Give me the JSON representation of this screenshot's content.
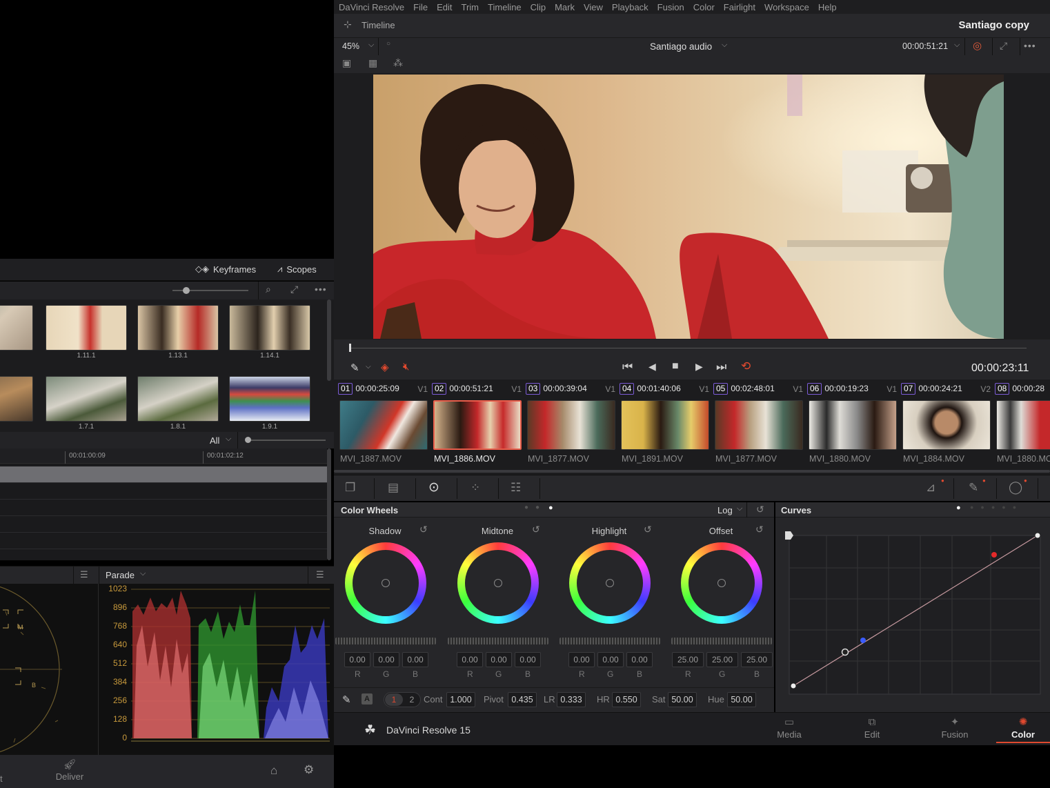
{
  "app": {
    "menu": [
      "DaVinci Resolve",
      "File",
      "Edit",
      "Trim",
      "Timeline",
      "Clip",
      "Mark",
      "View",
      "Playback",
      "Fusion",
      "Color",
      "Fairlight",
      "Workspace",
      "Help"
    ],
    "timeline_label": "Timeline",
    "project_title": "Santiago copy",
    "footer_brand": "DaVinci Resolve 15"
  },
  "viewer": {
    "zoom": "45%",
    "timeline_name": "Santiago audio",
    "source_tc": "00:00:51:21",
    "current_tc": "00:00:23:11"
  },
  "left": {
    "tabs": {
      "keyframes": "Keyframes",
      "scopes": "Scopes"
    },
    "gallery_row1": [
      "",
      "1.11.1",
      "1.13.1",
      "1.14.1"
    ],
    "gallery_row2": [
      "",
      "1.7.1",
      "1.8.1",
      "1.9.1"
    ],
    "filter": "All",
    "ruler": [
      "00:01:00:09",
      "00:01:02:12"
    ],
    "scope_mode": "Parade",
    "scope_scale": [
      "1023",
      "896",
      "768",
      "640",
      "512",
      "384",
      "256",
      "128",
      "0"
    ],
    "vector_labels": {
      "m": "M",
      "b": "B"
    },
    "page_left": "t",
    "page_deliver": "Deliver"
  },
  "clips": [
    {
      "num": "01",
      "tc": "00:00:25:09",
      "track": "V1",
      "name": "MVI_1887.MOV"
    },
    {
      "num": "02",
      "tc": "00:00:51:21",
      "track": "V1",
      "name": "MVI_1886.MOV"
    },
    {
      "num": "03",
      "tc": "00:00:39:04",
      "track": "V1",
      "name": "MVI_1877.MOV"
    },
    {
      "num": "04",
      "tc": "00:01:40:06",
      "track": "V1",
      "name": "MVI_1891.MOV"
    },
    {
      "num": "05",
      "tc": "00:02:48:01",
      "track": "V1",
      "name": "MVI_1877.MOV"
    },
    {
      "num": "06",
      "tc": "00:00:19:23",
      "track": "V1",
      "name": "MVI_1880.MOV"
    },
    {
      "num": "07",
      "tc": "00:00:24:21",
      "track": "V2",
      "name": "MVI_1884.MOV"
    },
    {
      "num": "08",
      "tc": "00:00:28",
      "track": "",
      "name": "MVI_1880.MO"
    }
  ],
  "color_wheels": {
    "title": "Color Wheels",
    "mode": "Log",
    "wheels": [
      {
        "name": "Shadow",
        "r": "0.00",
        "g": "0.00",
        "b": "0.00"
      },
      {
        "name": "Midtone",
        "r": "0.00",
        "g": "0.00",
        "b": "0.00"
      },
      {
        "name": "Highlight",
        "r": "0.00",
        "g": "0.00",
        "b": "0.00"
      },
      {
        "name": "Offset",
        "r": "25.00",
        "g": "25.00",
        "b": "25.00"
      }
    ],
    "rgb_labels": [
      "R",
      "G",
      "B"
    ],
    "page1": "1",
    "page2": "2",
    "auto": "A",
    "adjust": [
      {
        "label": "Cont",
        "value": "1.000"
      },
      {
        "label": "Pivot",
        "value": "0.435"
      },
      {
        "label": "LR",
        "value": "0.333"
      },
      {
        "label": "HR",
        "value": "0.550"
      },
      {
        "label": "Sat",
        "value": "50.00"
      },
      {
        "label": "Hue",
        "value": "50.00"
      }
    ]
  },
  "curves": {
    "title": "Curves"
  },
  "pages": [
    "Media",
    "Edit",
    "Fusion",
    "Color"
  ],
  "colors": {
    "accent": "#e0492f",
    "clip_border": "#7b5bd6",
    "selected_clip": "#e85c4a"
  }
}
